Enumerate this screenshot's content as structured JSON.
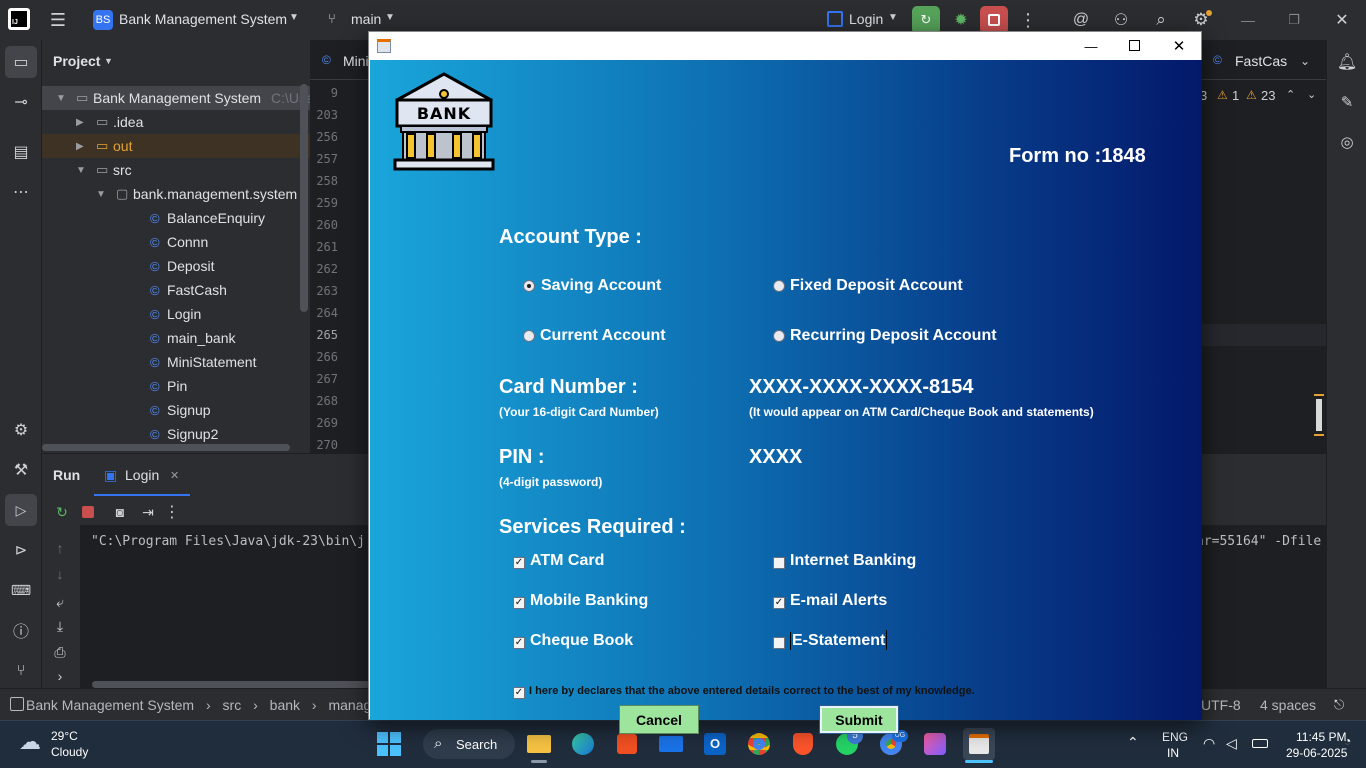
{
  "ide": {
    "project_badge": "BS",
    "project_name": "Bank Management System",
    "branch": "main",
    "run_config": "Login",
    "panel_title": "Project",
    "tree": [
      {
        "label": "Bank Management System",
        "extra": "C:\\Use",
        "level": 0,
        "kind": "module"
      },
      {
        "label": ".idea",
        "level": 1,
        "kind": "folder"
      },
      {
        "label": "out",
        "level": 1,
        "kind": "folder-out"
      },
      {
        "label": "src",
        "level": 1,
        "kind": "folder"
      },
      {
        "label": "bank.management.system",
        "level": 2,
        "kind": "package"
      },
      {
        "label": "BalanceEnquiry",
        "level": 3,
        "kind": "class"
      },
      {
        "label": "Connn",
        "level": 3,
        "kind": "class"
      },
      {
        "label": "Deposit",
        "level": 3,
        "kind": "class"
      },
      {
        "label": "FastCash",
        "level": 3,
        "kind": "class"
      },
      {
        "label": "Login",
        "level": 3,
        "kind": "class"
      },
      {
        "label": "main_bank",
        "level": 3,
        "kind": "class"
      },
      {
        "label": "MiniStatement",
        "level": 3,
        "kind": "class"
      },
      {
        "label": "Pin",
        "level": 3,
        "kind": "class"
      },
      {
        "label": "Signup",
        "level": 3,
        "kind": "class"
      },
      {
        "label": "Signup2",
        "level": 3,
        "kind": "class"
      }
    ],
    "editor_tab_left": "Mini",
    "editor_tab_right": "FastCas",
    "line_numbers": [
      "9",
      "203",
      "256",
      "257",
      "258",
      "259",
      "260",
      "261",
      "262",
      "263",
      "264",
      "265",
      "266",
      "267",
      "268",
      "269",
      "270"
    ],
    "inspections": {
      "warnings_a": "3",
      "warnings_b": "1",
      "weak": "23"
    },
    "run_tab": "Run",
    "run_config_tab": "Login",
    "console_line": "\"C:\\Program Files\\Java\\jdk-23\\bin\\j",
    "console_line_right": "ar=55164\" -Dfile",
    "breadcrumb": [
      "Bank Management System",
      "src",
      "bank",
      "managem"
    ],
    "encoding": "UTF-8",
    "indent": "4 spaces"
  },
  "dialog": {
    "form_no": "Form no :1848",
    "bank_logo_text": "BANK",
    "account_type_heading": "Account Type :",
    "account_types": [
      {
        "label": "Saving Account",
        "selected": true
      },
      {
        "label": "Fixed Deposit Account",
        "selected": false
      },
      {
        "label": "Current Account",
        "selected": false
      },
      {
        "label": "Recurring Deposit Account",
        "selected": false
      }
    ],
    "card_heading": "Card Number :",
    "card_hint": "(Your 16-digit Card Number)",
    "card_value": "XXXX-XXXX-XXXX-8154",
    "card_value_hint": "(It would appear on ATM Card/Cheque Book and statements)",
    "pin_heading": "PIN :",
    "pin_hint": "(4-digit password)",
    "pin_value": "XXXX",
    "services_heading": "Services Required :",
    "services": [
      {
        "label": "ATM Card",
        "checked": true
      },
      {
        "label": "Internet Banking",
        "checked": false
      },
      {
        "label": "Mobile Banking",
        "checked": true
      },
      {
        "label": "E-mail Alerts",
        "checked": true
      },
      {
        "label": "Cheque Book",
        "checked": true
      },
      {
        "label": "E-Statement",
        "checked": false
      }
    ],
    "declaration": "I here by declares that the above entered details correct to the best of my knowledge.",
    "declaration_checked": true,
    "cancel_label": "Cancel",
    "submit_label": "Submit"
  },
  "taskbar": {
    "weather_temp": "29°C",
    "weather_desc": "Cloudy",
    "search_label": "Search",
    "whatsapp_badge": "5",
    "chrome_badge": "UG",
    "lang_top": "ENG",
    "lang_bottom": "IN",
    "time": "11:45 PM",
    "date": "29-06-2025"
  },
  "colors": {
    "dialog_gradient_start": "#1aa6db",
    "dialog_gradient_end": "#04186a",
    "button_green": "#9de59d",
    "ide_bg": "#2b2d30"
  }
}
